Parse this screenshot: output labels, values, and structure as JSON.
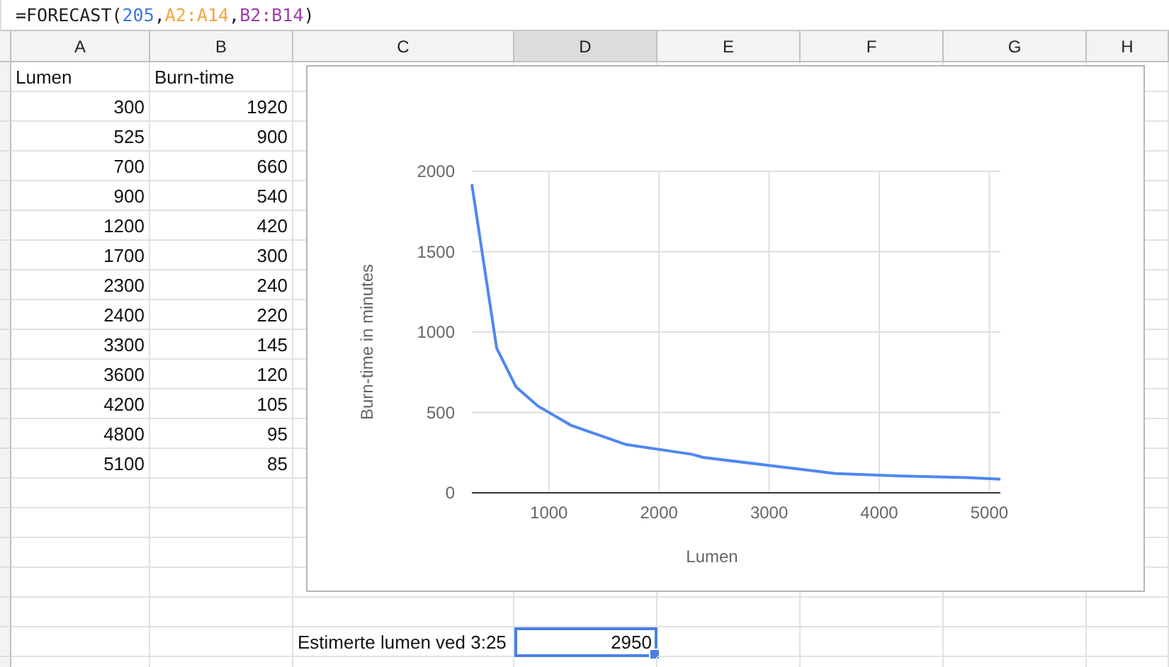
{
  "formula_bar": {
    "tokens": [
      {
        "text": "=FORECAST(",
        "kind": "plain"
      },
      {
        "text": "205",
        "kind": "number"
      },
      {
        "text": ",",
        "kind": "plain"
      },
      {
        "text": "A2:A14",
        "kind": "range1"
      },
      {
        "text": ",",
        "kind": "plain"
      },
      {
        "text": "B2:B14",
        "kind": "range2"
      },
      {
        "text": ")",
        "kind": "plain"
      }
    ]
  },
  "columns": [
    {
      "label": "A",
      "selected": false
    },
    {
      "label": "B",
      "selected": false
    },
    {
      "label": "C",
      "selected": false
    },
    {
      "label": "D",
      "selected": true
    },
    {
      "label": "E",
      "selected": false
    },
    {
      "label": "F",
      "selected": false
    },
    {
      "label": "G",
      "selected": false
    },
    {
      "label": "H",
      "selected": false
    }
  ],
  "rows": [
    {
      "cells": [
        {
          "text": "Lumen",
          "kind": "text",
          "selected": false
        },
        {
          "text": "Burn-time",
          "kind": "text",
          "selected": false
        }
      ]
    },
    {
      "cells": [
        {
          "text": "300",
          "kind": "number",
          "selected": false
        },
        {
          "text": "1920",
          "kind": "number",
          "selected": false
        }
      ]
    },
    {
      "cells": [
        {
          "text": "525",
          "kind": "number",
          "selected": false
        },
        {
          "text": "900",
          "kind": "number",
          "selected": false
        }
      ]
    },
    {
      "cells": [
        {
          "text": "700",
          "kind": "number",
          "selected": false
        },
        {
          "text": "660",
          "kind": "number",
          "selected": false
        }
      ]
    },
    {
      "cells": [
        {
          "text": "900",
          "kind": "number",
          "selected": false
        },
        {
          "text": "540",
          "kind": "number",
          "selected": false
        }
      ]
    },
    {
      "cells": [
        {
          "text": "1200",
          "kind": "number",
          "selected": false
        },
        {
          "text": "420",
          "kind": "number",
          "selected": false
        }
      ]
    },
    {
      "cells": [
        {
          "text": "1700",
          "kind": "number",
          "selected": false
        },
        {
          "text": "300",
          "kind": "number",
          "selected": false
        }
      ]
    },
    {
      "cells": [
        {
          "text": "2300",
          "kind": "number",
          "selected": false
        },
        {
          "text": "240",
          "kind": "number",
          "selected": false
        }
      ]
    },
    {
      "cells": [
        {
          "text": "2400",
          "kind": "number",
          "selected": false
        },
        {
          "text": "220",
          "kind": "number",
          "selected": false
        }
      ]
    },
    {
      "cells": [
        {
          "text": "3300",
          "kind": "number",
          "selected": false
        },
        {
          "text": "145",
          "kind": "number",
          "selected": false
        }
      ]
    },
    {
      "cells": [
        {
          "text": "3600",
          "kind": "number",
          "selected": false
        },
        {
          "text": "120",
          "kind": "number",
          "selected": false
        }
      ]
    },
    {
      "cells": [
        {
          "text": "4200",
          "kind": "number",
          "selected": false
        },
        {
          "text": "105",
          "kind": "number",
          "selected": false
        }
      ]
    },
    {
      "cells": [
        {
          "text": "4800",
          "kind": "number",
          "selected": false
        },
        {
          "text": "95",
          "kind": "number",
          "selected": false
        }
      ]
    },
    {
      "cells": [
        {
          "text": "5100",
          "kind": "number",
          "selected": false
        },
        {
          "text": "85",
          "kind": "number",
          "selected": false
        }
      ]
    },
    null,
    null,
    null,
    null,
    null,
    {
      "cells": [
        null,
        null,
        {
          "text": "Estimerte lumen ved 3:25",
          "kind": "text",
          "selected": false
        },
        {
          "text": "2950",
          "kind": "number",
          "selected": true
        }
      ]
    },
    null
  ],
  "chart": {
    "chart_data": {
      "type": "line",
      "xlabel": "Lumen",
      "ylabel": "Burn-time in minutes",
      "x": [
        300,
        525,
        700,
        900,
        1200,
        1700,
        2300,
        2400,
        3300,
        3600,
        4200,
        4800,
        5100
      ],
      "grid": true,
      "series": [
        {
          "color": "#4f87f0",
          "values": [
            1920,
            900,
            660,
            540,
            420,
            300,
            240,
            220,
            145,
            120,
            105,
            95,
            85
          ]
        }
      ],
      "xlim": [
        300,
        5100
      ],
      "ylim": [
        0,
        2000
      ],
      "xticks": [
        1000,
        2000,
        3000,
        4000,
        5000
      ],
      "yticks": [
        0,
        500,
        1000,
        1500,
        2000
      ]
    }
  }
}
